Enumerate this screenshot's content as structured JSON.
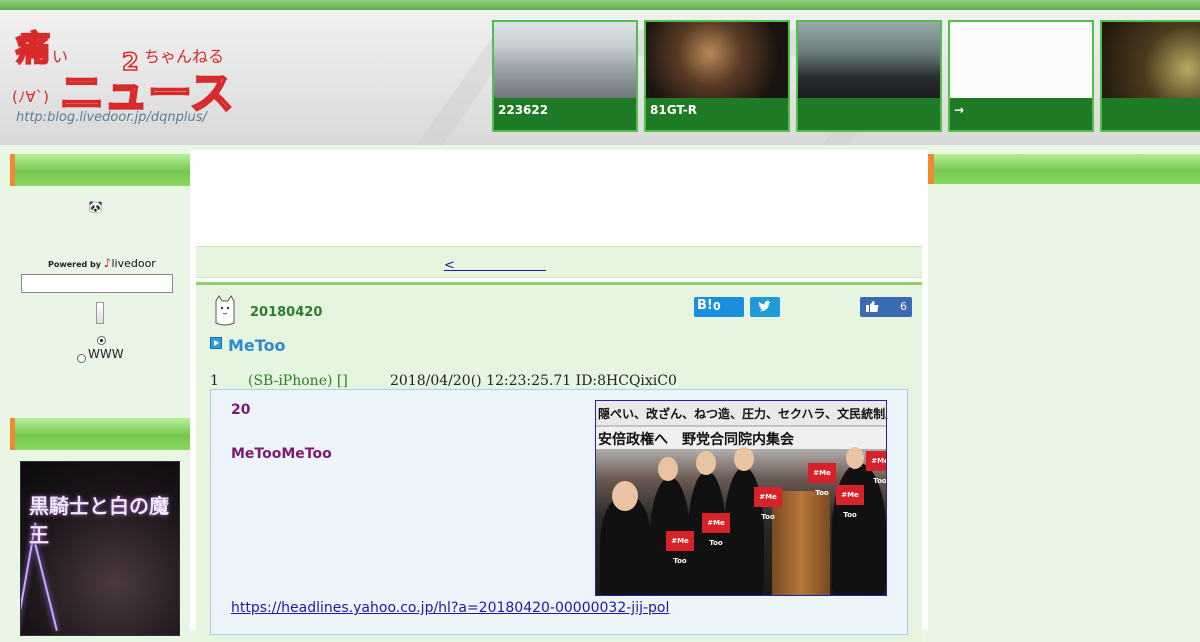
{
  "header": {
    "logo_url": "http:blog.livedoor.jp/dqnplus/",
    "thumbnails": [
      {
        "caption": "223622"
      },
      {
        "caption": "81GT-R"
      },
      {
        "caption": ""
      },
      {
        "caption": "→"
      },
      {
        "caption": ""
      }
    ]
  },
  "sidebar": {
    "face": "🐼",
    "powered_by": "Powered by",
    "livedoor": "livedoor",
    "www_label": "WWW",
    "banner_title": "黒騎士と白の魔王"
  },
  "nav": {
    "prev_link": "<　　　　　　　"
  },
  "post": {
    "date": "20180420",
    "hatena_count": "0",
    "like_count": "6",
    "title": "MeToo",
    "res_number": "1",
    "res_name": "(SB-iPhone) []",
    "res_stamp": "2018/04/20() 12:23:25.71 ID:8HCQixiC0",
    "body_line1": "20",
    "body_line2": "MeTooMeToo",
    "link": "https://headlines.yahoo.co.jp/hl?a=20180420-00000032-jij-pol",
    "photo_banner1": "隠ぺい、改ざん、ねつ造、圧力、セクハラ、文民統制崩壊",
    "photo_banner2": "安倍政権へ　野党合同院内集会",
    "photo_sign": "#Me Too"
  },
  "colors": {
    "accent_green": "#2f7d2a",
    "title_blue": "#2f8ad0",
    "body_purple": "#7a1a72",
    "link_blue": "#1a1aa6",
    "sidebar_orange": "#f08a30"
  }
}
